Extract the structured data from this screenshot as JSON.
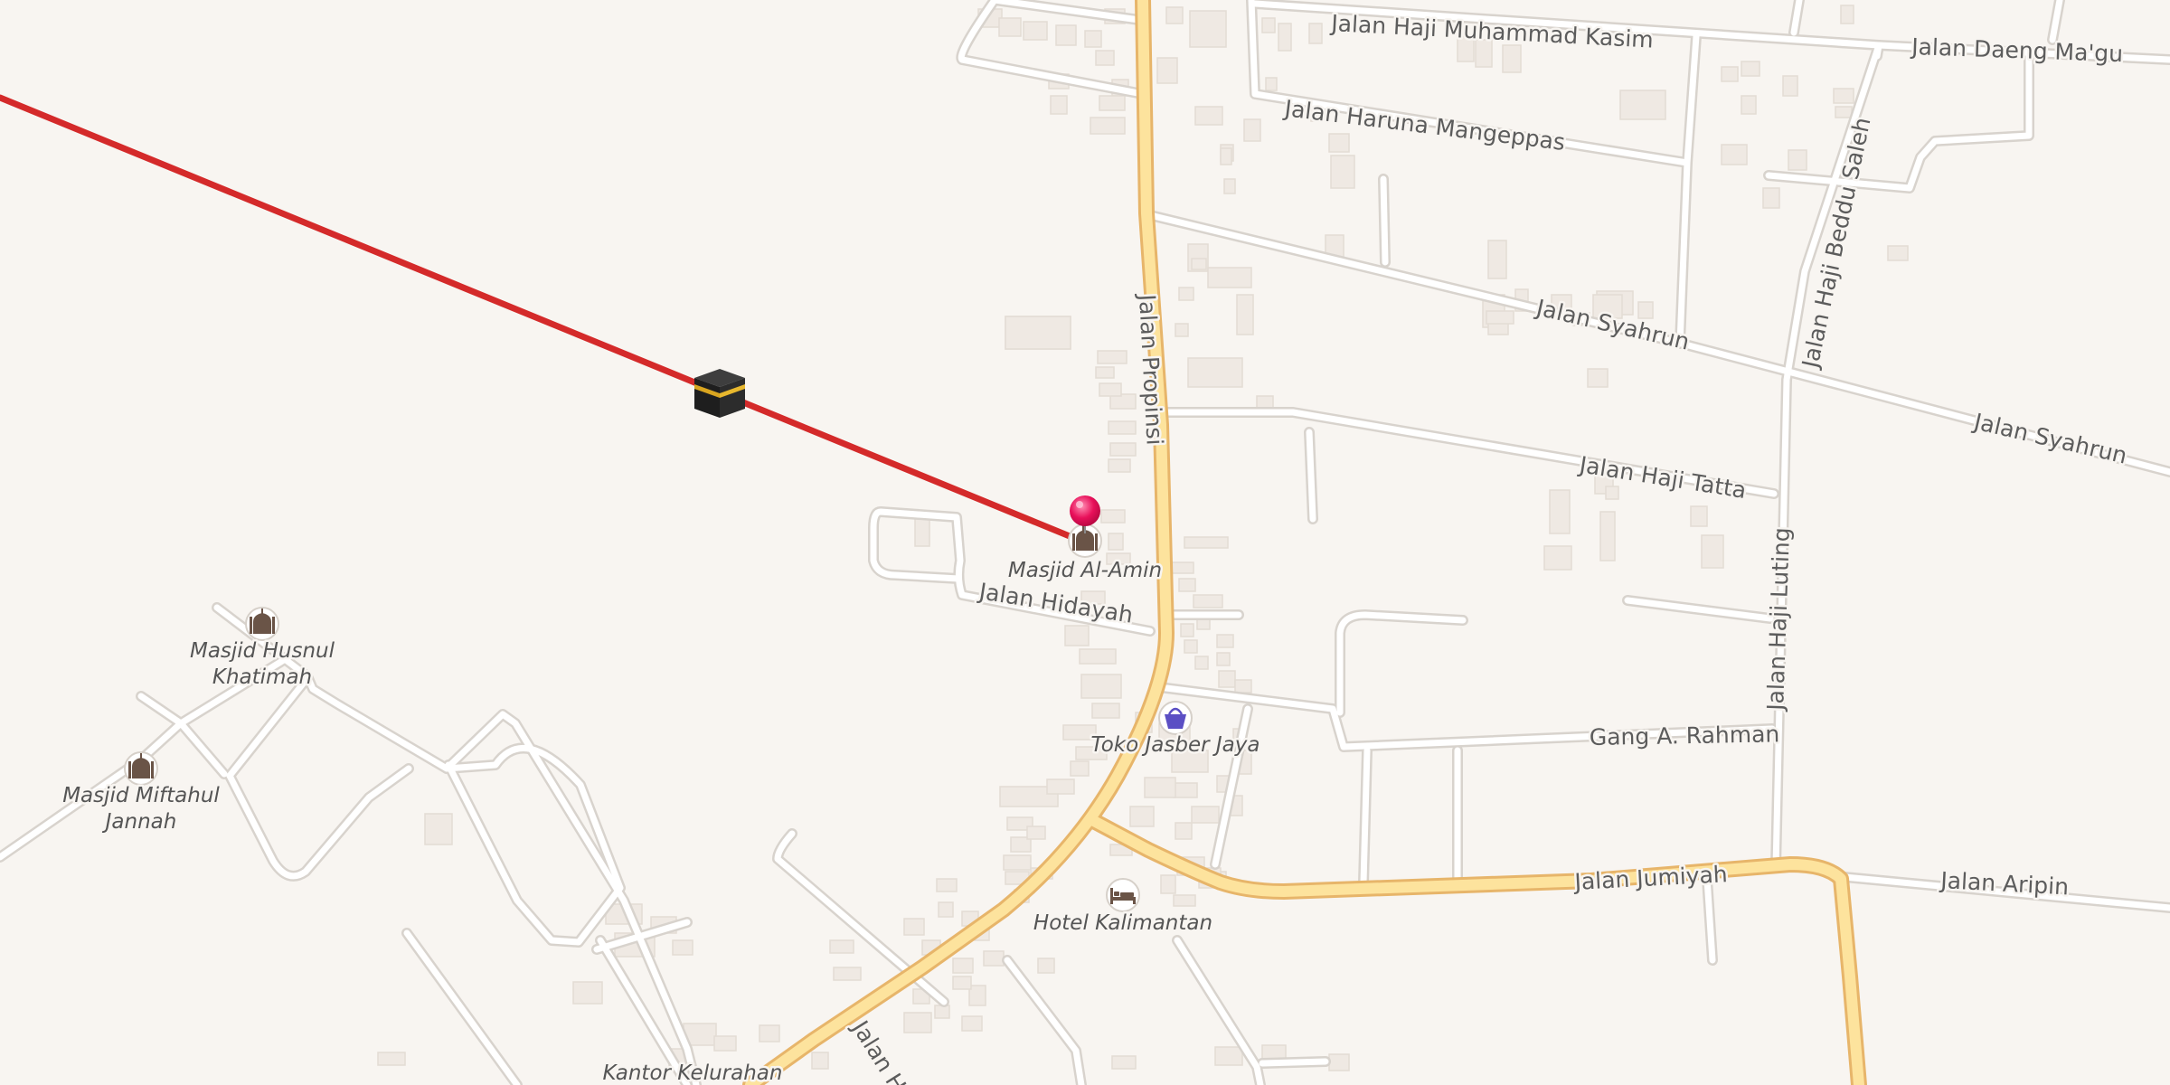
{
  "map": {
    "background_color": "#f8f5f1",
    "colors": {
      "qibla_line": "#d42a2a",
      "main_road": "#fde39d",
      "minor_road": "#ffffff",
      "pin": "#e8105a",
      "shop_icon": "#5b4fc4"
    },
    "qibla_marker": {
      "icon": "kaaba-icon"
    },
    "location_pin": {
      "icon": "map-pin-icon"
    },
    "streets": [
      {
        "id": "jalan-propinsi",
        "label": "Jalan Propinsi"
      },
      {
        "id": "jalan-haji-muhammad-kasim",
        "label": "Jalan Haji Muhammad Kasim"
      },
      {
        "id": "jalan-daeng-magu",
        "label": "Jalan Daeng Ma'gu"
      },
      {
        "id": "jalan-haruna-mangeppas",
        "label": "Jalan Haruna Mangeppas"
      },
      {
        "id": "jalan-syahrun-1",
        "label": "Jalan Syahrun"
      },
      {
        "id": "jalan-syahrun-2",
        "label": "Jalan Syahrun"
      },
      {
        "id": "jalan-haji-beddu-saleh",
        "label": "Jalan Haji Beddu Saleh"
      },
      {
        "id": "jalan-haji-tatta",
        "label": "Jalan Haji Tatta"
      },
      {
        "id": "jalan-haji-luting",
        "label": "Jalan Haji Luting"
      },
      {
        "id": "jalan-hidayah",
        "label": "Jalan Hidayah"
      },
      {
        "id": "gang-a-rahman",
        "label": "Gang A. Rahman"
      },
      {
        "id": "jalan-jumiyah",
        "label": "Jalan Jumiyah"
      },
      {
        "id": "jalan-aripin",
        "label": "Jalan Aripin"
      },
      {
        "id": "jalan-h",
        "label": "Jalan H"
      }
    ],
    "pois": [
      {
        "id": "masjid-al-amin",
        "lines": [
          "Masjid Al-Amin"
        ],
        "icon": "mosque-icon"
      },
      {
        "id": "masjid-husnul-khatimah",
        "lines": [
          "Masjid Husnul",
          "Khatimah"
        ],
        "icon": "mosque-icon"
      },
      {
        "id": "masjid-miftahul-jannah",
        "lines": [
          "Masjid Miftahul",
          "Jannah"
        ],
        "icon": "mosque-icon"
      },
      {
        "id": "toko-jasber-jaya",
        "lines": [
          "Toko Jasber Jaya"
        ],
        "icon": "shopping-basket-icon"
      },
      {
        "id": "hotel-kalimantan",
        "lines": [
          "Hotel Kalimantan"
        ],
        "icon": "bed-icon"
      },
      {
        "id": "kantor-kelurahan",
        "lines": [
          "Kantor Kelurahan"
        ],
        "icon": ""
      }
    ]
  }
}
